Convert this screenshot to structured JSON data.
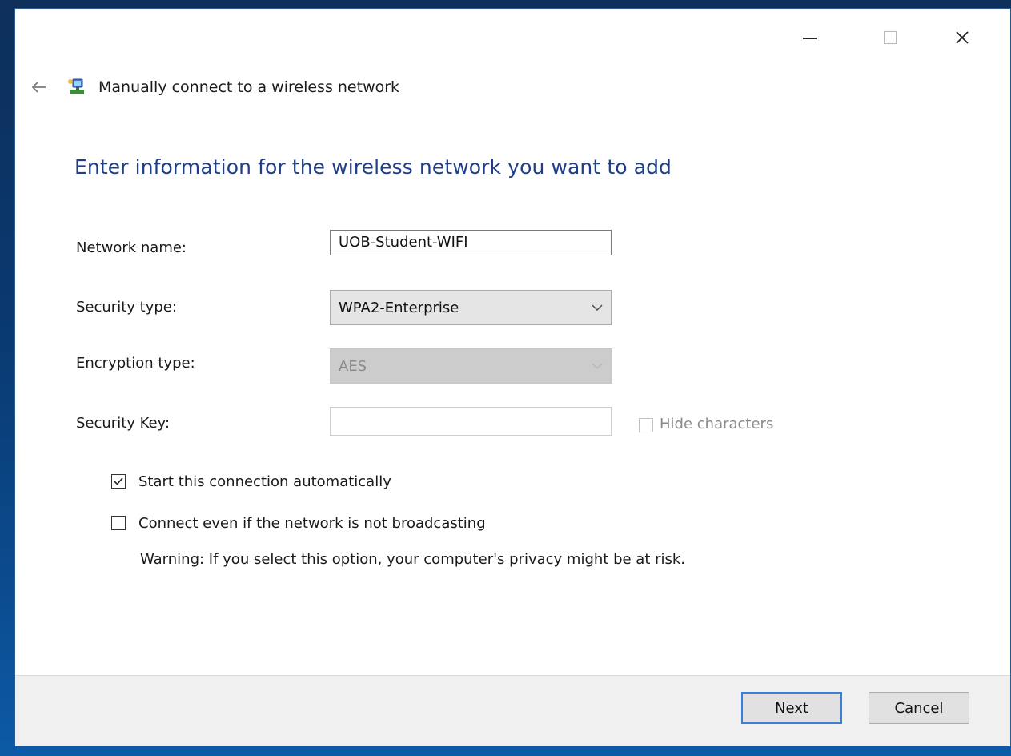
{
  "window": {
    "breadcrumb": "Manually connect to a wireless network",
    "heading": "Enter information for the wireless network you want to add"
  },
  "form": {
    "network_name": {
      "label": "Network name:",
      "value": "UOB-Student-WIFI"
    },
    "security_type": {
      "label": "Security type:",
      "value": "WPA2-Enterprise"
    },
    "encryption_type": {
      "label": "Encryption type:",
      "value": "AES"
    },
    "security_key": {
      "label": "Security Key:",
      "value": "",
      "hide_characters_label": "Hide characters",
      "hide_characters_checked": false
    },
    "start_automatically": {
      "label": "Start this connection automatically",
      "checked": true
    },
    "connect_not_broadcasting": {
      "label": "Connect even if the network is not broadcasting",
      "checked": false
    },
    "warning": "Warning: If you select this option, your computer's privacy might be at risk."
  },
  "footer": {
    "next_label": "Next",
    "cancel_label": "Cancel"
  },
  "colors": {
    "heading": "#1e3f87",
    "primary_border": "#3c7fd6",
    "footer_bg": "#f0f0f0"
  },
  "icons": [
    "minimize-icon",
    "maximize-icon",
    "close-icon",
    "back-arrow-icon",
    "network-icon",
    "chevron-down-icon",
    "checkmark-icon"
  ]
}
